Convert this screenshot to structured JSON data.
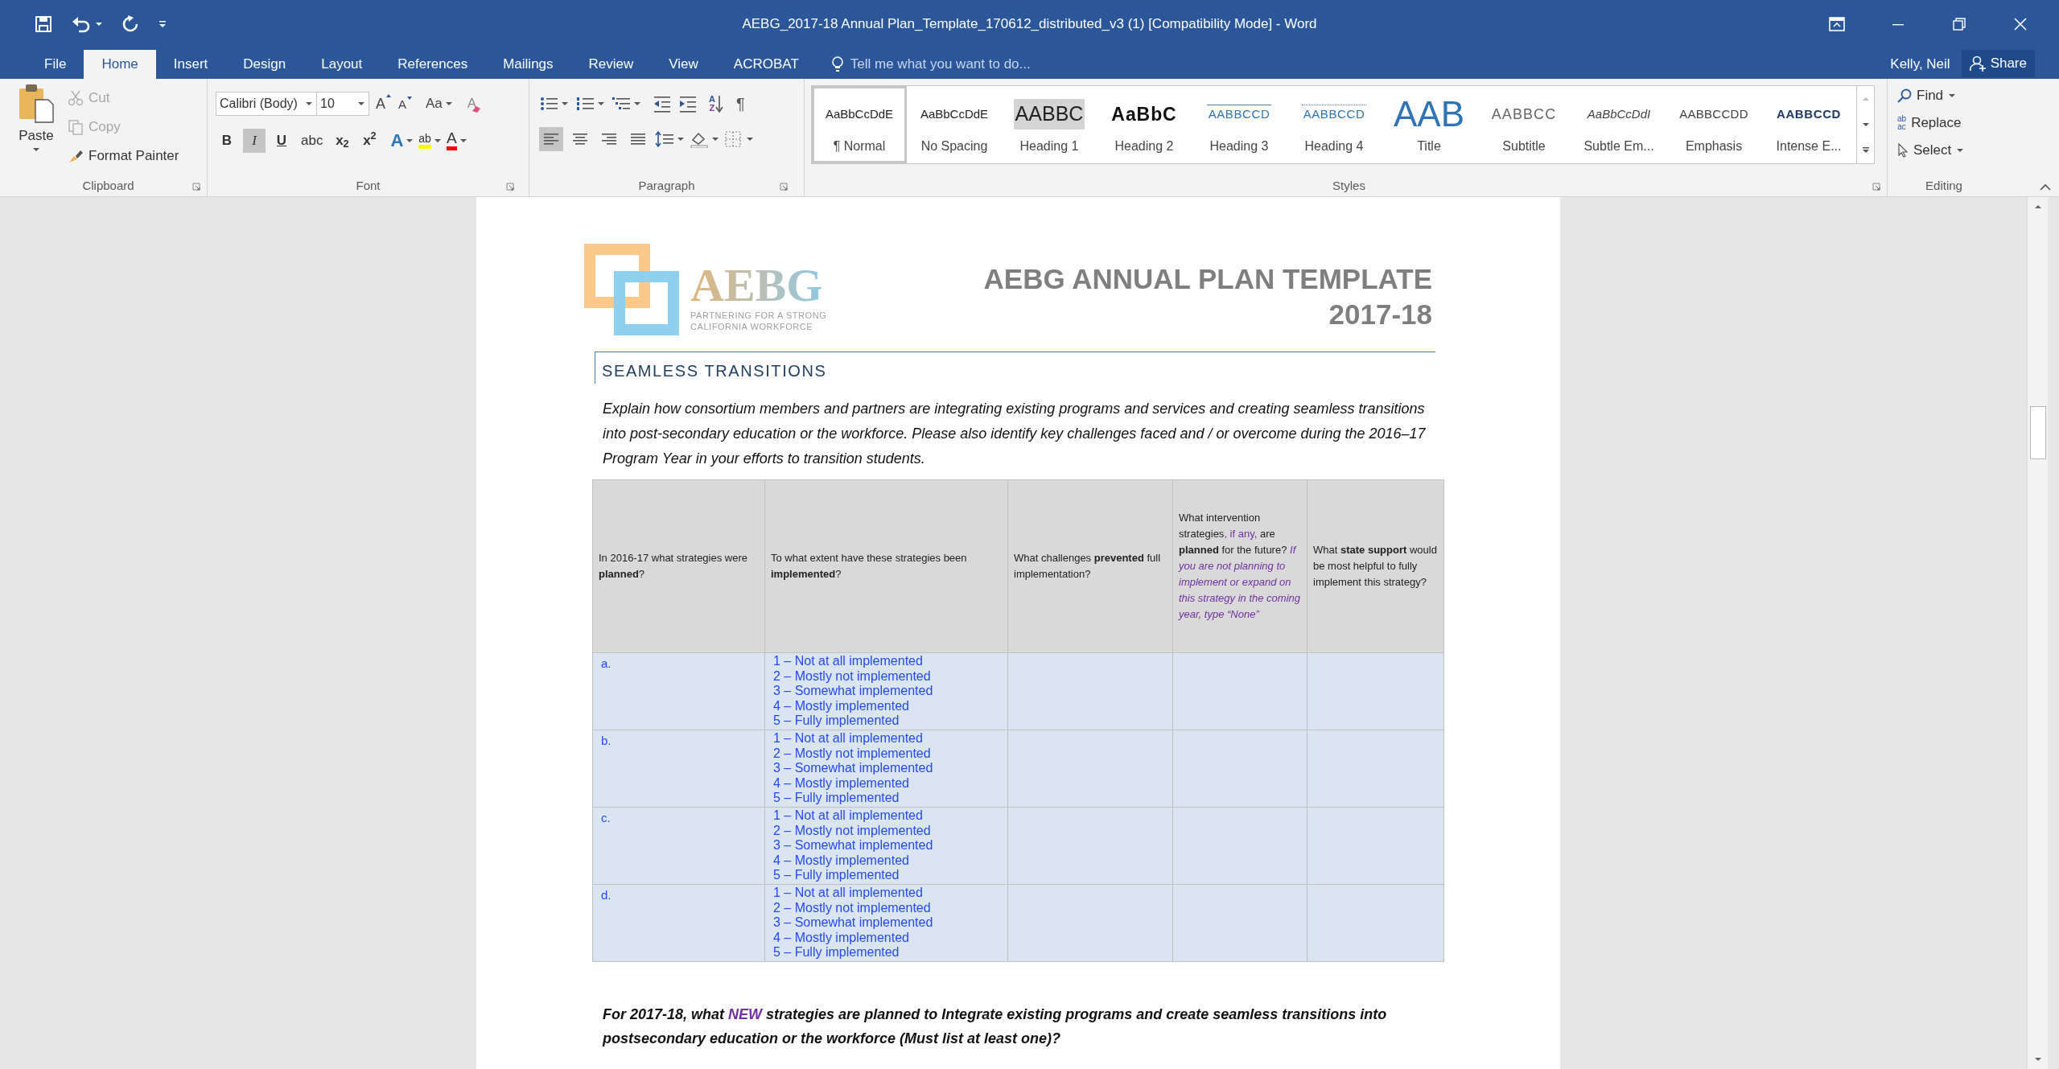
{
  "window": {
    "title": "AEBG_2017-18 Annual Plan_Template_170612_distributed_v3 (1) [Compatibility Mode] - Word"
  },
  "tabs": [
    {
      "label": "File",
      "selected": false
    },
    {
      "label": "Home",
      "selected": true
    },
    {
      "label": "Insert",
      "selected": false
    },
    {
      "label": "Design",
      "selected": false
    },
    {
      "label": "Layout",
      "selected": false
    },
    {
      "label": "References",
      "selected": false
    },
    {
      "label": "Mailings",
      "selected": false
    },
    {
      "label": "Review",
      "selected": false
    },
    {
      "label": "View",
      "selected": false
    },
    {
      "label": "ACROBAT",
      "selected": false
    }
  ],
  "tell_me": {
    "placeholder": "Tell me what you want to do..."
  },
  "user": "Kelly, Neil",
  "share_button": "Share",
  "clipboard": {
    "label": "Clipboard",
    "paste": "Paste",
    "commands": [
      {
        "label": "Cut",
        "kind": "cut",
        "disabled": true
      },
      {
        "label": "Copy",
        "kind": "copy",
        "disabled": true
      },
      {
        "label": "Format Painter",
        "kind": "painter",
        "disabled": false
      }
    ]
  },
  "font": {
    "label": "Font",
    "font_name": "Calibri (Body)",
    "font_size": "10",
    "grow": "A",
    "shrink": "A",
    "change_case": "Aa",
    "clear_formatting": "A",
    "text_effects": "A",
    "highlight": "ab",
    "font_color": "A",
    "format_buttons": [
      {
        "label": "B",
        "kind": "bold",
        "selected": false
      },
      {
        "label": "I",
        "kind": "italic",
        "selected": true
      },
      {
        "label": "U",
        "kind": "underline",
        "selected": false
      },
      {
        "label": "abc",
        "kind": "strike",
        "selected": false
      },
      {
        "label": "x$_{2}$",
        "kind": "sub",
        "selected": false
      },
      {
        "label": "x$^{2}$",
        "kind": "sup",
        "selected": false
      }
    ]
  },
  "paragraph": {
    "label": "Paragraph",
    "sort_letters": [
      "A",
      "Z"
    ],
    "show_marks": "¶",
    "align": [
      {
        "kind": "left",
        "selected": true
      },
      {
        "kind": "center",
        "selected": false
      },
      {
        "kind": "right",
        "selected": false
      },
      {
        "kind": "justify",
        "selected": false
      }
    ]
  },
  "styles": {
    "label": "Styles",
    "items": [
      {
        "preview": "AaBbCcDdE",
        "name": "¶ Normal",
        "kind": "normal",
        "selected": true,
        "hovered": false
      },
      {
        "preview": "AaBbCcDdE",
        "name": "No Spacing",
        "kind": "nospacing",
        "selected": false,
        "hovered": false
      },
      {
        "preview": "AABBC",
        "name": "Heading 1",
        "kind": "heading1",
        "selected": false,
        "hovered": true
      },
      {
        "preview": "AaBbC",
        "name": "Heading 2",
        "kind": "heading2",
        "selected": false,
        "hovered": false
      },
      {
        "preview": "AABBCCD",
        "name": "Heading 3",
        "kind": "heading3",
        "selected": false,
        "hovered": false
      },
      {
        "preview": "AABBCCD",
        "name": "Heading 4",
        "kind": "heading4",
        "selected": false,
        "hovered": false
      },
      {
        "preview": "AAB",
        "name": "Title",
        "kind": "title",
        "selected": false,
        "hovered": false
      },
      {
        "preview": "AABBCC",
        "name": "Subtitle",
        "kind": "subtitle",
        "selected": false,
        "hovered": false
      },
      {
        "preview": "AaBbCcDdI",
        "name": "Subtle Em...",
        "kind": "subtle",
        "selected": false,
        "hovered": false
      },
      {
        "preview": "AABBCCDD",
        "name": "Emphasis",
        "kind": "emphasis",
        "selected": false,
        "hovered": false
      },
      {
        "preview": "AABBCCD",
        "name": "Intense E...",
        "kind": "intense",
        "selected": false,
        "hovered": false
      }
    ]
  },
  "editing": {
    "label": "Editing",
    "find": "Find",
    "replace": "Replace",
    "replace_icon": [
      "ab",
      "ac"
    ],
    "select": "Select"
  },
  "document": {
    "logo": {
      "name": "AEBG",
      "tagline": [
        "PARTNERING FOR A STRONG",
        "CALIFORNIA WORKFORCE"
      ]
    },
    "title": [
      "AEBG ANNUAL PLAN TEMPLATE",
      "2017-18"
    ],
    "section_heading": "SEAMLESS TRANSITIONS",
    "intro": "Explain how consortium members and partners are integrating existing programs and services and creating seamless transitions into post-secondary education or the workforce. Please also identify key challenges faced and / or overcome during the 2016–17 Program Year in your efforts to transition students.",
    "table": {
      "header": [
        [
          {
            "text": "In 2016-17 what strategies were ",
            "kind": "plain"
          },
          {
            "text": "planned",
            "kind": "bold"
          },
          {
            "text": "?",
            "kind": "plain"
          }
        ],
        [
          {
            "text": "To what extent have these strategies been ",
            "kind": "plain"
          },
          {
            "text": "implemented",
            "kind": "bold"
          },
          {
            "text": "?",
            "kind": "plain"
          }
        ],
        [
          {
            "text": "What challenges ",
            "kind": "plain"
          },
          {
            "text": "prevented",
            "kind": "bold"
          },
          {
            "text": " full implementation?",
            "kind": "plain"
          }
        ],
        [
          {
            "text": "What intervention strategies",
            "kind": "plain"
          },
          {
            "text": ", if any,",
            "kind": "accent"
          },
          {
            "text": " are ",
            "kind": "plain"
          },
          {
            "text": "planned",
            "kind": "bold"
          },
          {
            "text": " for the future? ",
            "kind": "plain"
          },
          {
            "text": "If you are not planning to implement or expand on this strategy in the coming year, type “None”",
            "kind": "accentitalic"
          }
        ],
        [
          {
            "text": "What ",
            "kind": "plain"
          },
          {
            "text": "state support",
            "kind": "bold"
          },
          {
            "text": " would be most helpful to fully implement this strategy?",
            "kind": "plain"
          }
        ]
      ],
      "rows": [
        {
          "label": "a.",
          "options": [
            "1 – Not at all implemented",
            "2 – Mostly not implemented",
            "3 – Somewhat implemented",
            "4 – Mostly implemented",
            "5 – Fully implemented"
          ]
        },
        {
          "label": "b.",
          "options": [
            "1 – Not at all implemented",
            "2 – Mostly not implemented",
            "3 – Somewhat implemented",
            "4 – Mostly implemented",
            "5 – Fully implemented"
          ]
        },
        {
          "label": "c.",
          "options": [
            "1 – Not at all implemented",
            "2 – Mostly not implemented",
            "3 – Somewhat implemented",
            "4 – Mostly implemented",
            "5 – Fully implemented"
          ]
        },
        {
          "label": "d.",
          "options": [
            "1 – Not at all implemented",
            "2 – Mostly not implemented",
            "3 – Somewhat implemented",
            "4 – Mostly implemented",
            "5 – Fully implemented"
          ]
        }
      ]
    },
    "question": [
      {
        "text": "For 2017-18, what ",
        "kind": "plain"
      },
      {
        "text": "NEW",
        "kind": "accent"
      },
      {
        "text": " strategies are planned to Integrate existing programs and create seamless transitions into postsecondary education or the workforce (Must list at least one)?",
        "kind": "plain"
      }
    ]
  }
}
